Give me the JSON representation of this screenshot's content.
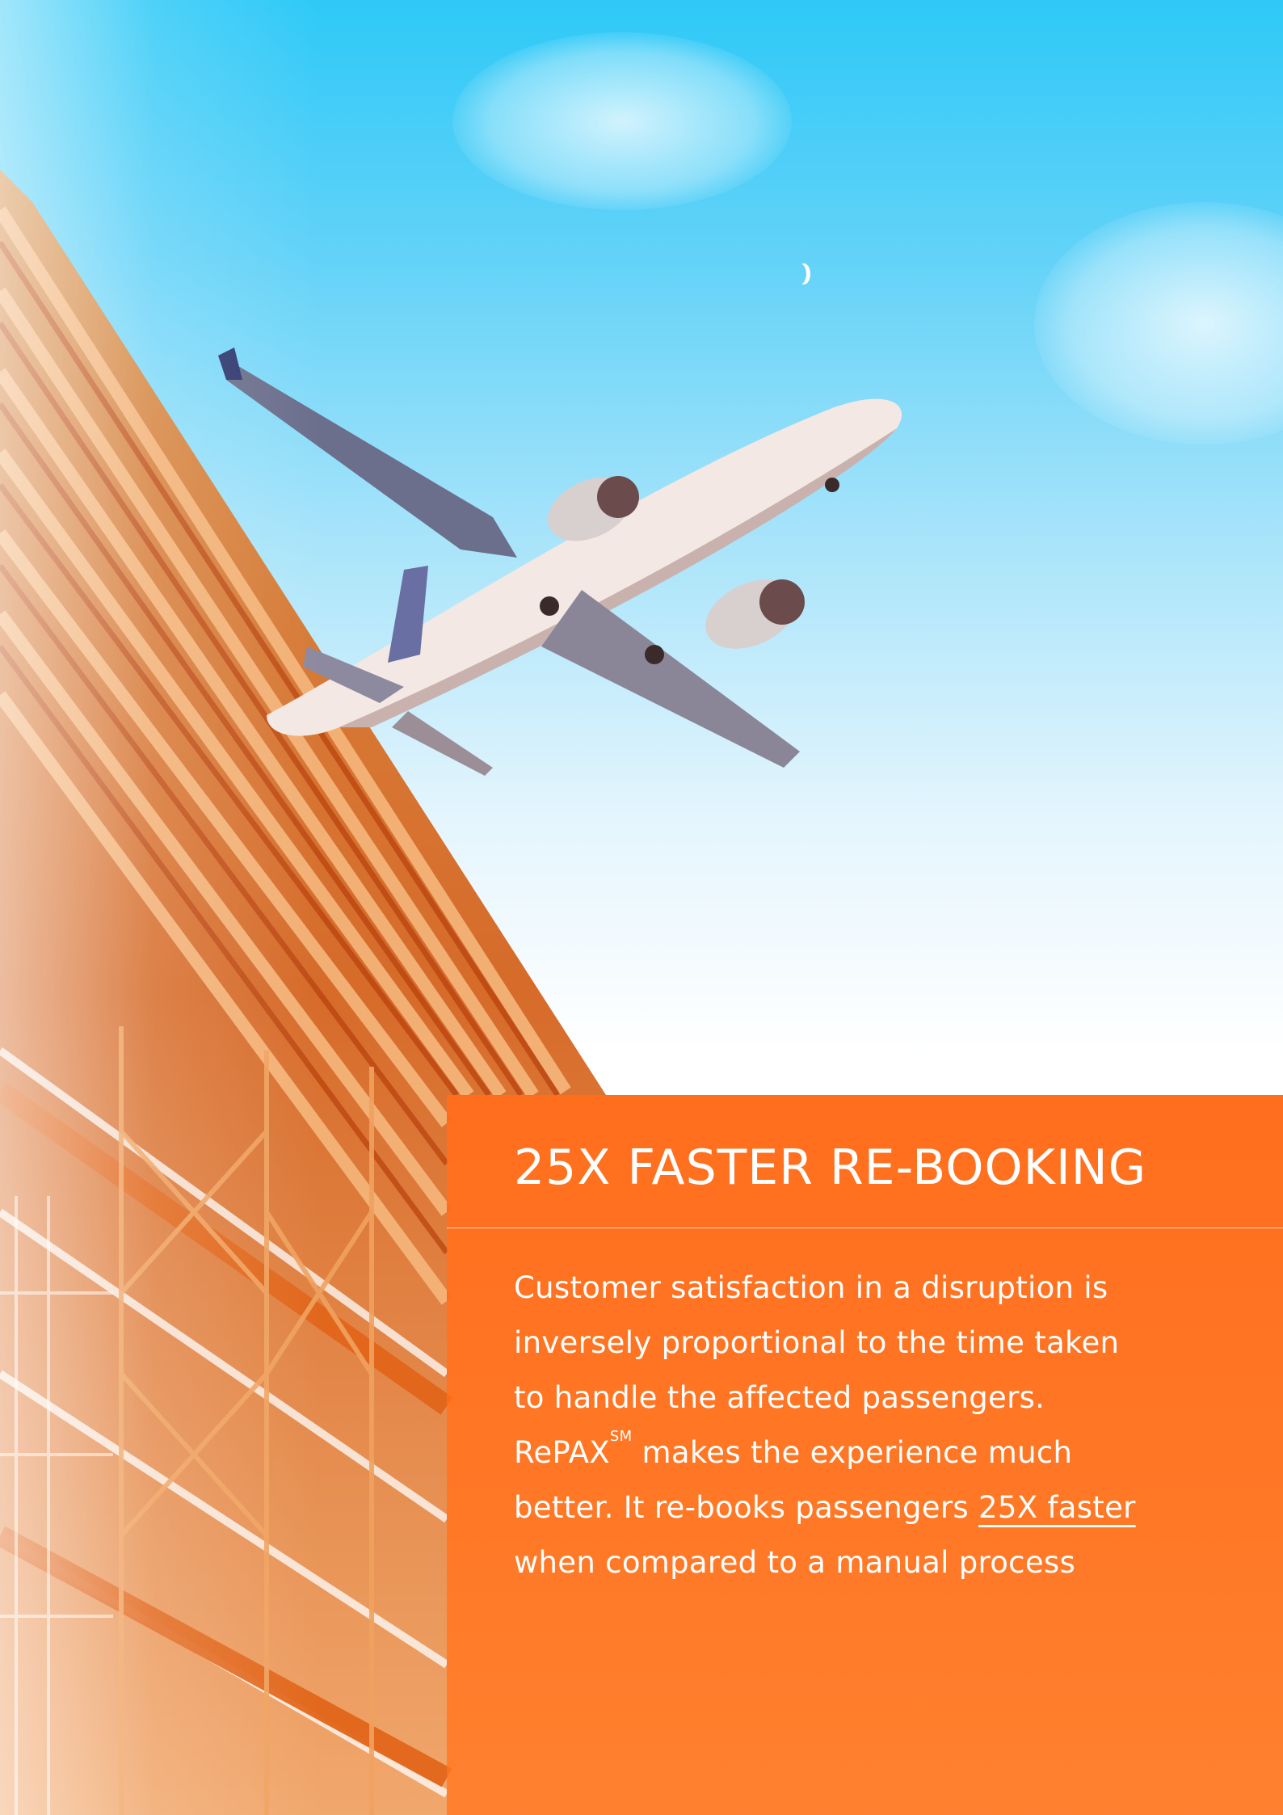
{
  "background": {
    "description_icon": "airplane-photo",
    "sky_color": "#2ec9f7",
    "structure_color": "#f07a1a"
  },
  "panel": {
    "accent_color": "#ff6a14",
    "title": "25X FASTER RE-BOOKING",
    "body": {
      "line1": "Customer satisfaction in a disruption is",
      "line2": "inversely proportional to the time taken",
      "line3": "to handle the affected passengers.",
      "line4_product": "RePAX",
      "line4_mark": "SM",
      "line4_rest": " makes the experience much",
      "line5_before": "better. It re-books passengers ",
      "line5_highlight": "25X faster",
      "line6": "when compared to a manual process"
    }
  }
}
